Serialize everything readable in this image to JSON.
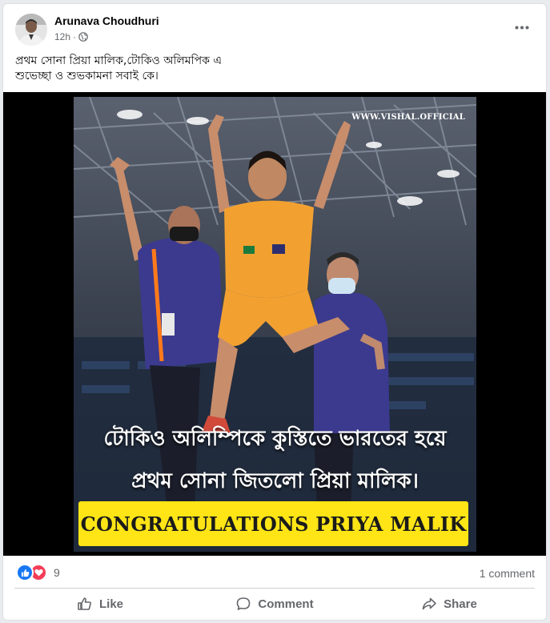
{
  "post": {
    "author": "Arunava Choudhuri",
    "time": "12h",
    "separator": "·",
    "caption_line1": "প্রথম সোনা প্রিয়া মালিক,টোকিও অলিমপিক এ",
    "caption_line2": "শুভেচ্ছা ও শুভকামনা সবাই কে।"
  },
  "image": {
    "watermark": "WWW.VISHAL.OFFICIAL",
    "overlay_line1": "টোকিও অলিম্পিকে কুস্তিতে ভারতের হয়ে",
    "overlay_line2": "প্রথম সোনা জিতলো প্রিয়া মালিক।",
    "banner_text": "CONGRATULATIONS PRIYA MALIK"
  },
  "stats": {
    "reaction_count": "9",
    "comments": "1 comment"
  },
  "actions": {
    "like": "Like",
    "comment": "Comment",
    "share": "Share"
  },
  "colors": {
    "like_blue": "#1877f2",
    "love_red": "#f33e58",
    "banner_yellow": "#ffe515",
    "secondary_text": "#65676b"
  },
  "icons": [
    "globe-icon",
    "more-options-icon",
    "like-reaction-icon",
    "love-reaction-icon",
    "like-icon",
    "comment-icon",
    "share-icon"
  ]
}
